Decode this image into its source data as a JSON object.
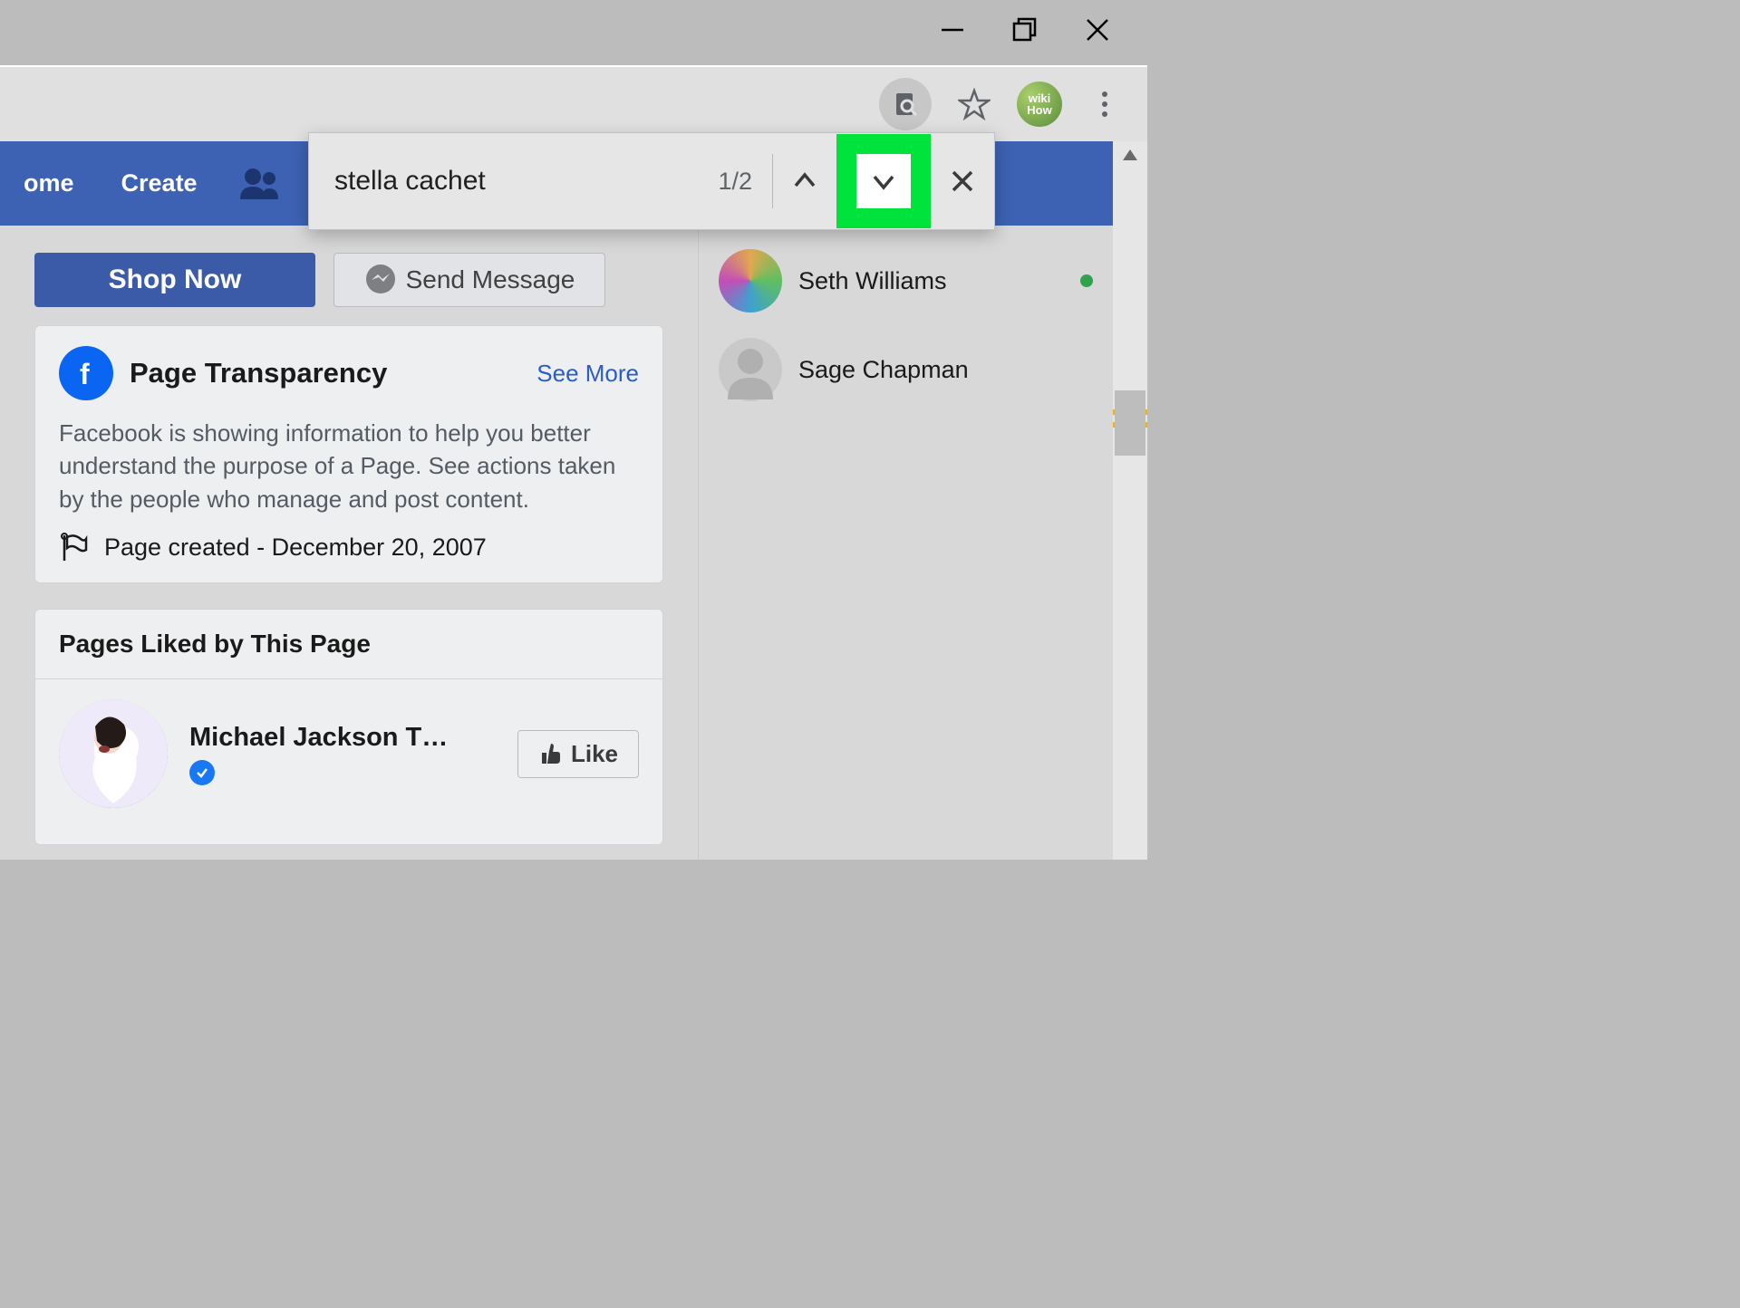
{
  "window": {
    "minimize": "—",
    "maximize": "▢",
    "close": "✕"
  },
  "chrome": {
    "wikihow_top": "wiki",
    "wikihow_bottom": "How"
  },
  "find": {
    "query": "stella cachet",
    "count": "1/2"
  },
  "fb_nav": {
    "home": "ome",
    "create": "Create"
  },
  "actions": {
    "shop": "Shop Now",
    "send_message": "Send Message"
  },
  "transparency": {
    "title": "Page Transparency",
    "see_more": "See More",
    "body": "Facebook is showing information to help you better understand the purpose of a Page. See actions taken by the people who manage and post content.",
    "created": "Page created - December 20, 2007"
  },
  "liked_pages": {
    "title": "Pages Liked by This Page",
    "item_name": "Michael Jackson T…",
    "like_label": "Like"
  },
  "chat": [
    {
      "name": "Seth Williams",
      "online": true,
      "colorful": true
    },
    {
      "name": "Sage Chapman",
      "online": false,
      "colorful": false
    }
  ]
}
